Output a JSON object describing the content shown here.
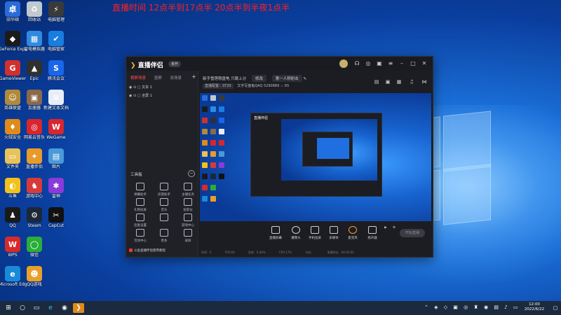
{
  "banner": "直播时间 12点半到17点半   20点半到半夜1点半",
  "desktop_icons": [
    {
      "label": "旧华硕",
      "color": "#2b6bd8",
      "glyph": "卓",
      "col": 0,
      "row": 0
    },
    {
      "label": "回收站",
      "color": "#c0c8d0",
      "glyph": "♻",
      "col": 1,
      "row": 0
    },
    {
      "label": "电脑管理",
      "color": "#3a3a3a",
      "glyph": "⚡",
      "col": 2,
      "row": 0
    },
    {
      "label": "GeForce Experience",
      "color": "#1b1b1b",
      "glyph": "◆",
      "col": 0,
      "row": 1
    },
    {
      "label": "雷电模拟器",
      "color": "#2f8ae0",
      "glyph": "▦",
      "col": 1,
      "row": 1
    },
    {
      "label": "电脑管家",
      "color": "#1a7de0",
      "glyph": "✔",
      "col": 2,
      "row": 1
    },
    {
      "label": "GameViewer",
      "color": "#d03030",
      "glyph": "G",
      "col": 0,
      "row": 2
    },
    {
      "label": "Epic",
      "color": "#303030",
      "glyph": "▲",
      "col": 1,
      "row": 2
    },
    {
      "label": "腾讯会议",
      "color": "#1966e8",
      "glyph": "S",
      "col": 2,
      "row": 2
    },
    {
      "label": "英雄联盟",
      "color": "#b08a3a",
      "glyph": "☺",
      "col": 0,
      "row": 3
    },
    {
      "label": "加速器",
      "color": "#8a6a4a",
      "glyph": "▣",
      "col": 1,
      "row": 3
    },
    {
      "label": "新建文本文档",
      "color": "#e8eef6",
      "glyph": "≡",
      "col": 2,
      "row": 3
    },
    {
      "label": "火绒安全",
      "color": "#e08a1a",
      "glyph": "♦",
      "col": 0,
      "row": 4
    },
    {
      "label": "网易云音乐",
      "color": "#d8262e",
      "glyph": "◎",
      "col": 1,
      "row": 4
    },
    {
      "label": "WeGame",
      "color": "#d8262e",
      "glyph": "W",
      "col": 2,
      "row": 4
    },
    {
      "label": "文件夹",
      "color": "#e8c25a",
      "glyph": "▭",
      "col": 0,
      "row": 5
    },
    {
      "label": "直播伴侣",
      "color": "#e89a2a",
      "glyph": "✦",
      "col": 1,
      "row": 5
    },
    {
      "label": "图片",
      "color": "#4a9ad8",
      "glyph": "▤",
      "col": 2,
      "row": 5
    },
    {
      "label": "斗鱼",
      "color": "#f2c21a",
      "glyph": "◐",
      "col": 0,
      "row": 6
    },
    {
      "label": "游戏中心",
      "color": "#d83a3a",
      "glyph": "♞",
      "col": 1,
      "row": 6
    },
    {
      "label": "雷神",
      "color": "#8a3ad8",
      "glyph": "✱",
      "col": 2,
      "row": 6
    },
    {
      "label": "QQ",
      "color": "#1a1a1a",
      "glyph": "♟",
      "col": 0,
      "row": 7
    },
    {
      "label": "Steam",
      "color": "#1b2838",
      "glyph": "⚙",
      "col": 1,
      "row": 7
    },
    {
      "label": "CapCut",
      "color": "#111111",
      "glyph": "✂",
      "col": 2,
      "row": 7
    },
    {
      "label": "WPS",
      "color": "#d82a2a",
      "glyph": "W",
      "col": 0,
      "row": 8
    },
    {
      "label": "微信",
      "color": "#2aae3a",
      "glyph": "◯",
      "col": 1,
      "row": 8
    },
    {
      "label": "Microsoft Edge",
      "color": "#1a8ad8",
      "glyph": "e",
      "col": 0,
      "row": 9
    },
    {
      "label": "QQ游戏",
      "color": "#e8a02a",
      "glyph": "☻",
      "col": 1,
      "row": 9
    }
  ],
  "app": {
    "logo_text": "直播伴侣",
    "version_badge": "未开",
    "scene_tabs": [
      "横屏场景",
      "竖屏",
      "双场景"
    ],
    "sources": [
      "文本 1",
      "全屏 1"
    ],
    "toolbox_title": "工具箱",
    "toolbox_toggle": "−",
    "tools": [
      "弹幕助手",
      "房管助手",
      "主播任务",
      "礼物投屏",
      "音乐",
      "投影仪",
      "连麦设置",
      "",
      "游戏中心",
      "活动中心",
      "更多",
      "录屏"
    ],
    "bottom_tip": "斗鱼直播伴侣使用教程",
    "room_title": "新手雪莲限盘龟 只跳上分",
    "edit_chip": "修改",
    "category_chip": "第一人称射击",
    "room_badge": "直播配置：ST20",
    "anchor_id": "文字写盘龟QAQ  5290889",
    "hot_value": "65",
    "preview_logo": "直播伴侣",
    "bottom_buttons": [
      "直播屏幕",
      "摄像头",
      "手机投屏",
      "多媒体",
      "麦克风",
      "扬声器"
    ],
    "go_live": "开始直播",
    "status_items": [
      "码率：0",
      "FPS:60",
      "丢帧：0.00%",
      "CPU:17%",
      "内存：",
      "直播时长：00:00:00"
    ]
  },
  "taskbar": {
    "search_placeholder": "",
    "clock_time": "12:00",
    "clock_date": "2022/6/22"
  }
}
